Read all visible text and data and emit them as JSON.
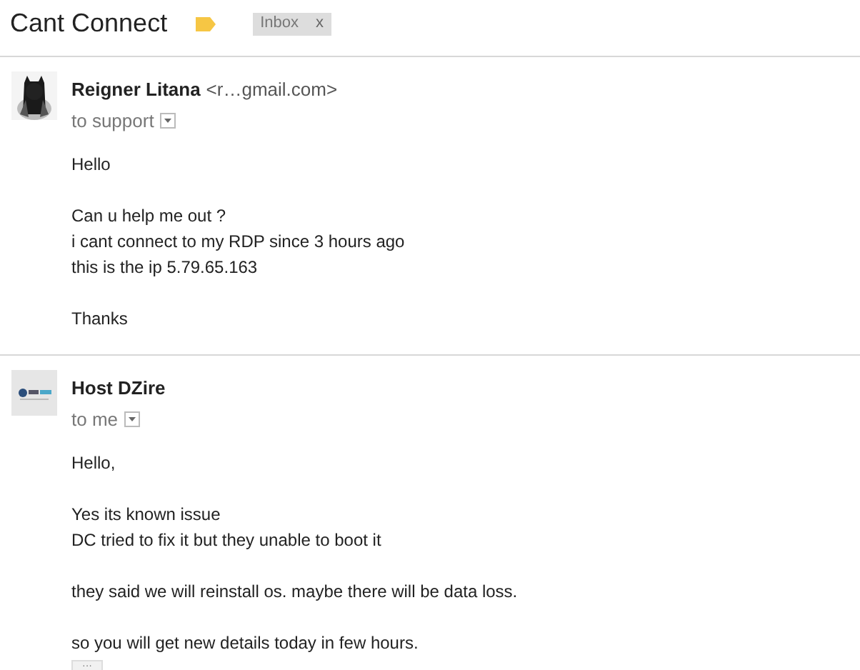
{
  "subject": "Cant Connect",
  "labels": [
    {
      "text": "Inbox",
      "close": "x"
    }
  ],
  "messages": [
    {
      "avatar": {
        "kind": "picture"
      },
      "sender": "Reigner Litana",
      "email": "<r…gmail.com>",
      "recipient": "to support",
      "paragraphs": [
        [
          "Hello"
        ],
        [
          "Can u help me out ?",
          "i cant connect to my RDP since 3 hours ago",
          "this is the ip 5.79.65.163"
        ],
        [
          "Thanks"
        ]
      ]
    },
    {
      "avatar": {
        "kind": "picture"
      },
      "sender": "Host DZire",
      "recipient": "to me",
      "paragraphs": [
        [
          "Hello,"
        ],
        [
          "Yes its known issue",
          "DC tried to fix it but they unable to boot it"
        ],
        [
          "they said we will reinstall os. maybe there will be data loss."
        ],
        [
          "so you will get new details today in few hours."
        ]
      ],
      "more": "···"
    }
  ]
}
